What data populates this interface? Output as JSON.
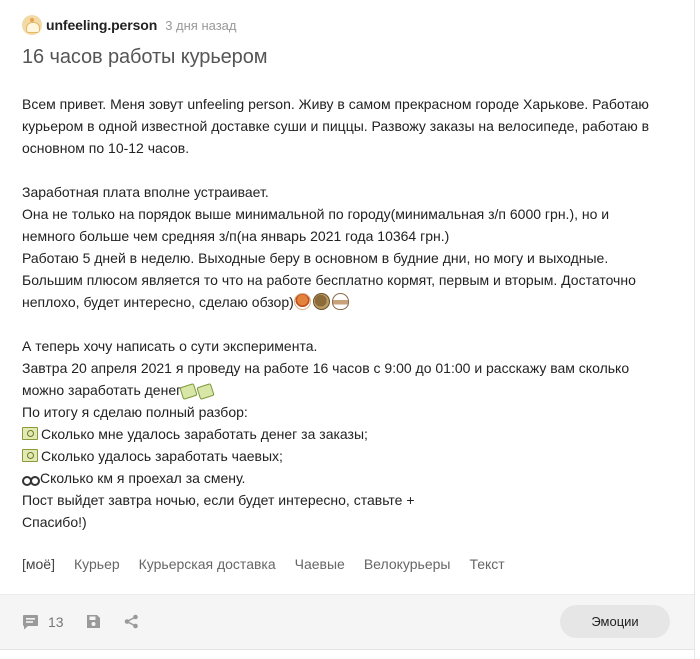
{
  "post": {
    "author": "unfeeling.person",
    "time": "3 дня назад",
    "title": "16 часов работы курьером",
    "lines": [
      "Всем привет. Меня зовут unfeeling person. Живу в самом прекрасном городе Харькове. Работаю",
      "курьером в одной известной доставке суши и пиццы. Развожу заказы на велосипеде, работаю в",
      "основном по 10-12 часов.",
      "Заработная плата вполне устраивает.",
      "Она не только на порядок выше минимальной по городу(минимальная з/п 6000 грн.), но и",
      "немного больше чем средняя з/п(на январь 2021 года 10364 грн.)",
      "Работаю 5 дней в неделю. Выходные беру в основном в будние дни, но могу и выходные.",
      "Большим плюсом является то что на работе бесплатно кормят, первым и вторым. Достаточно",
      "неплохо, будет интересно, сделаю обзор)",
      "А теперь хочу написать о сути эксперимента.",
      "Завтра 20 апреля 2021 я проведу на работе 16 часов с 9:00 до 01:00 и расскажу вам сколько",
      "можно заработать денег",
      "По итогу я сделаю полный разбор:",
      "Сколько мне удалось заработать денег за заказы;",
      "Сколько удалось заработать чаевых;",
      "Сколько км я проехал за смену.",
      "Пост выйдет завтра ночью, если будет интересно, ставьте +",
      "Спасибо!)"
    ],
    "icons": {
      "food_emojis": [
        "curry-dish-icon",
        "falafel-icon",
        "hot-drink-icon"
      ],
      "money_emojis": [
        "flying-money-icon",
        "flying-money-icon"
      ],
      "bullet_money": "banknote-icon",
      "bullet_bike": "bicycle-icon"
    }
  },
  "tags": [
    "[моё]",
    "Курьер",
    "Курьерская доставка",
    "Чаевые",
    "Велокурьеры",
    "Текст"
  ],
  "footer": {
    "comments_count": "13",
    "emotions_label": "Эмоции"
  }
}
